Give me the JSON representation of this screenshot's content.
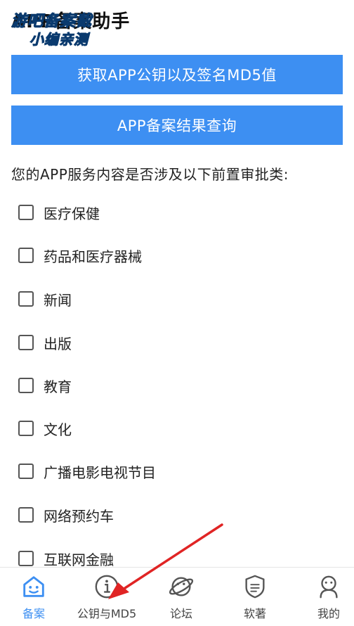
{
  "header": {
    "title": "APP备案助手",
    "watermark_line1": "游吧备案截",
    "watermark_line2": "小编亲测"
  },
  "buttons": {
    "get_key": "获取APP公钥以及签名MD5值",
    "query": "APP备案结果查询"
  },
  "question": "您的APP服务内容是否涉及以下前置审批类:",
  "options": [
    {
      "label": "医疗保健",
      "checked": false
    },
    {
      "label": "药品和医疗器械",
      "checked": false
    },
    {
      "label": "新闻",
      "checked": false
    },
    {
      "label": "出版",
      "checked": false
    },
    {
      "label": "教育",
      "checked": false
    },
    {
      "label": "文化",
      "checked": false
    },
    {
      "label": "广播电影电视节目",
      "checked": false
    },
    {
      "label": "网络预约车",
      "checked": false
    },
    {
      "label": "互联网金融",
      "checked": false
    }
  ],
  "tabs": [
    {
      "label": "备案",
      "icon": "home-robot-icon",
      "active": true
    },
    {
      "label": "公钥与MD5",
      "icon": "info-icon",
      "active": false
    },
    {
      "label": "论坛",
      "icon": "planet-icon",
      "active": false
    },
    {
      "label": "软著",
      "icon": "certificate-shield-icon",
      "active": false
    },
    {
      "label": "我的",
      "icon": "user-icon",
      "active": false
    }
  ],
  "colors": {
    "accent": "#3d8ff2",
    "annotation_arrow": "#e02424"
  }
}
